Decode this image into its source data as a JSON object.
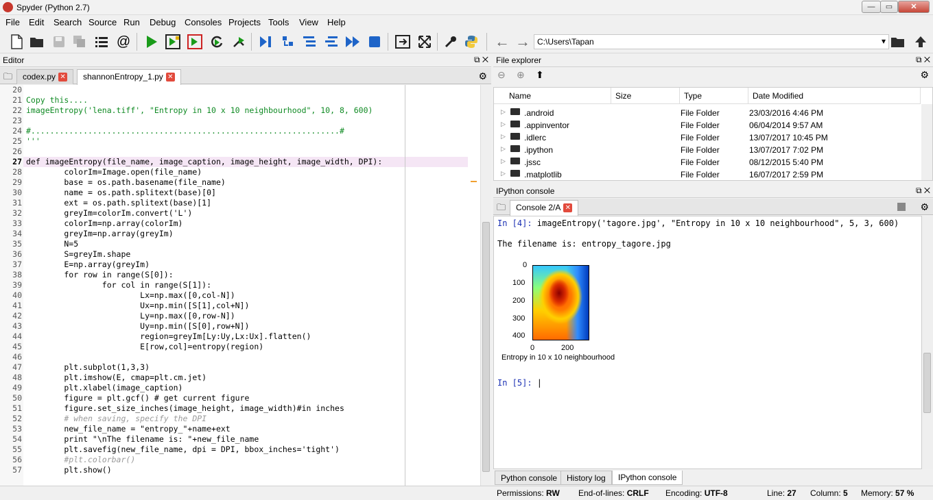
{
  "window": {
    "title": "Spyder (Python 2.7)",
    "min": "—",
    "max": "▭",
    "close": "✕"
  },
  "menu": [
    "File",
    "Edit",
    "Search",
    "Source",
    "Run",
    "Debug",
    "Consoles",
    "Projects",
    "Tools",
    "View",
    "Help"
  ],
  "toolbar": {
    "icons": [
      "new-file-icon",
      "open-file-icon",
      "save-icon",
      "save-all-icon",
      "list-icon",
      "at-icon",
      "run-icon",
      "run-cell-icon",
      "run-cell-advance-icon",
      "rerun-icon",
      "run-selection-icon",
      "debug-icon",
      "step-icon",
      "step-into-icon",
      "step-return-icon",
      "continue-icon",
      "stop-icon",
      "maximize-pane-icon",
      "fullscreen-icon",
      "preferences-icon",
      "python-path-icon"
    ],
    "back": "←",
    "forward": "→",
    "path": "C:\\Users\\Tapan",
    "path_dropdown": "▾"
  },
  "editor": {
    "pane_title": "Editor",
    "tabs": [
      {
        "label": "codex.py",
        "active": false
      },
      {
        "label": "shannonEntropy_1.py",
        "active": true
      }
    ],
    "lines": [
      {
        "n": "20",
        "text": ""
      },
      {
        "n": "21",
        "text": "Copy this....",
        "cls": "str"
      },
      {
        "n": "22",
        "text": "imageEntropy('lena.tiff', \"Entropy in 10 x 10 neighbourhood\", 10, 8, 600)",
        "cls": "str"
      },
      {
        "n": "23",
        "text": ""
      },
      {
        "n": "24",
        "text": "#.................................................................#",
        "cls": "str"
      },
      {
        "n": "25",
        "text": "'''",
        "cls": "str"
      },
      {
        "n": "26",
        "text": ""
      },
      {
        "n": "27",
        "text": "def imageEntropy(file_name, image_caption, image_height, image_width, DPI):"
      },
      {
        "n": "28",
        "text": "        colorIm=Image.open(file_name)"
      },
      {
        "n": "29",
        "text": "        base = os.path.basename(file_name)"
      },
      {
        "n": "30",
        "text": "        name = os.path.splitext(base)[0]"
      },
      {
        "n": "31",
        "text": "        ext = os.path.splitext(base)[1]"
      },
      {
        "n": "32",
        "text": "        greyIm=colorIm.convert('L')"
      },
      {
        "n": "33",
        "text": "        colorIm=np.array(colorIm)"
      },
      {
        "n": "34",
        "text": "        greyIm=np.array(greyIm)"
      },
      {
        "n": "35",
        "text": "        N=5"
      },
      {
        "n": "36",
        "text": "        S=greyIm.shape"
      },
      {
        "n": "37",
        "text": "        E=np.array(greyIm)"
      },
      {
        "n": "38",
        "text": "        for row in range(S[0]):"
      },
      {
        "n": "39",
        "text": "                for col in range(S[1]):"
      },
      {
        "n": "40",
        "text": "                        Lx=np.max([0,col-N])"
      },
      {
        "n": "41",
        "text": "                        Ux=np.min([S[1],col+N])"
      },
      {
        "n": "42",
        "text": "                        Ly=np.max([0,row-N])"
      },
      {
        "n": "43",
        "text": "                        Uy=np.min([S[0],row+N])"
      },
      {
        "n": "44",
        "text": "                        region=greyIm[Ly:Uy,Lx:Ux].flatten()"
      },
      {
        "n": "45",
        "text": "                        E[row,col]=entropy(region)"
      },
      {
        "n": "46",
        "text": ""
      },
      {
        "n": "47",
        "text": "        plt.subplot(1,3,3)"
      },
      {
        "n": "48",
        "text": "        plt.imshow(E, cmap=plt.cm.jet)"
      },
      {
        "n": "49",
        "text": "        plt.xlabel(image_caption)"
      },
      {
        "n": "50",
        "text": "        figure = plt.gcf() # get current figure"
      },
      {
        "n": "51",
        "text": "        figure.set_size_inches(image_height, image_width)#in inches"
      },
      {
        "n": "52",
        "text": "        # when saving, specify the DPI",
        "cls": "cm"
      },
      {
        "n": "53",
        "text": "        new_file_name = \"entropy_\"+name+ext"
      },
      {
        "n": "54",
        "text": "        print \"\\nThe filename is: \"+new_file_name"
      },
      {
        "n": "55",
        "text": "        plt.savefig(new_file_name, dpi = DPI, bbox_inches='tight')"
      },
      {
        "n": "56",
        "text": "        #plt.colorbar()",
        "cls": "cm"
      },
      {
        "n": "57",
        "text": "        plt.show()"
      }
    ]
  },
  "file_explorer": {
    "pane_title": "File explorer",
    "columns": [
      "Name",
      "Size",
      "Type",
      "Date Modified"
    ],
    "rows": [
      {
        "name": ".android",
        "size": "",
        "type": "File Folder",
        "date": "23/03/2016 4:46 PM"
      },
      {
        "name": ".appinventor",
        "size": "",
        "type": "File Folder",
        "date": "06/04/2014 9:57 AM"
      },
      {
        "name": ".idlerc",
        "size": "",
        "type": "File Folder",
        "date": "13/07/2017 10:45 PM"
      },
      {
        "name": ".ipython",
        "size": "",
        "type": "File Folder",
        "date": "13/07/2017 7:02 PM"
      },
      {
        "name": ".jssc",
        "size": "",
        "type": "File Folder",
        "date": "08/12/2015 5:40 PM"
      },
      {
        "name": ".matplotlib",
        "size": "",
        "type": "File Folder",
        "date": "16/07/2017 2:59 PM"
      }
    ]
  },
  "ipython": {
    "pane_title": "IPython console",
    "tab": "Console 2/A",
    "in4_prompt": "In [4]: ",
    "in4_cmd": "imageEntropy('tagore.jpg', \"Entropy in 10 x 10 neighbourhood\", 5, 3, 600)",
    "output": "The filename is: entropy_tagore.jpg",
    "plot": {
      "y_ticks": [
        "0",
        "100",
        "200",
        "300",
        "400"
      ],
      "x_ticks": [
        "0",
        "200"
      ],
      "xlabel": "Entropy in 10 x 10 neighbourhood"
    },
    "in5_prompt": "In [5]: ",
    "bottom_tabs": [
      {
        "label": "Python console",
        "active": false
      },
      {
        "label": "History log",
        "active": false
      },
      {
        "label": "IPython console",
        "active": true
      }
    ]
  },
  "status": {
    "permissions_label": "Permissions:",
    "permissions": "RW",
    "eol_label": "End-of-lines:",
    "eol": "CRLF",
    "encoding_label": "Encoding:",
    "encoding": "UTF-8",
    "line_label": "Line:",
    "line": "27",
    "column_label": "Column:",
    "column": "5",
    "memory_label": "Memory:",
    "memory": "57 %"
  }
}
